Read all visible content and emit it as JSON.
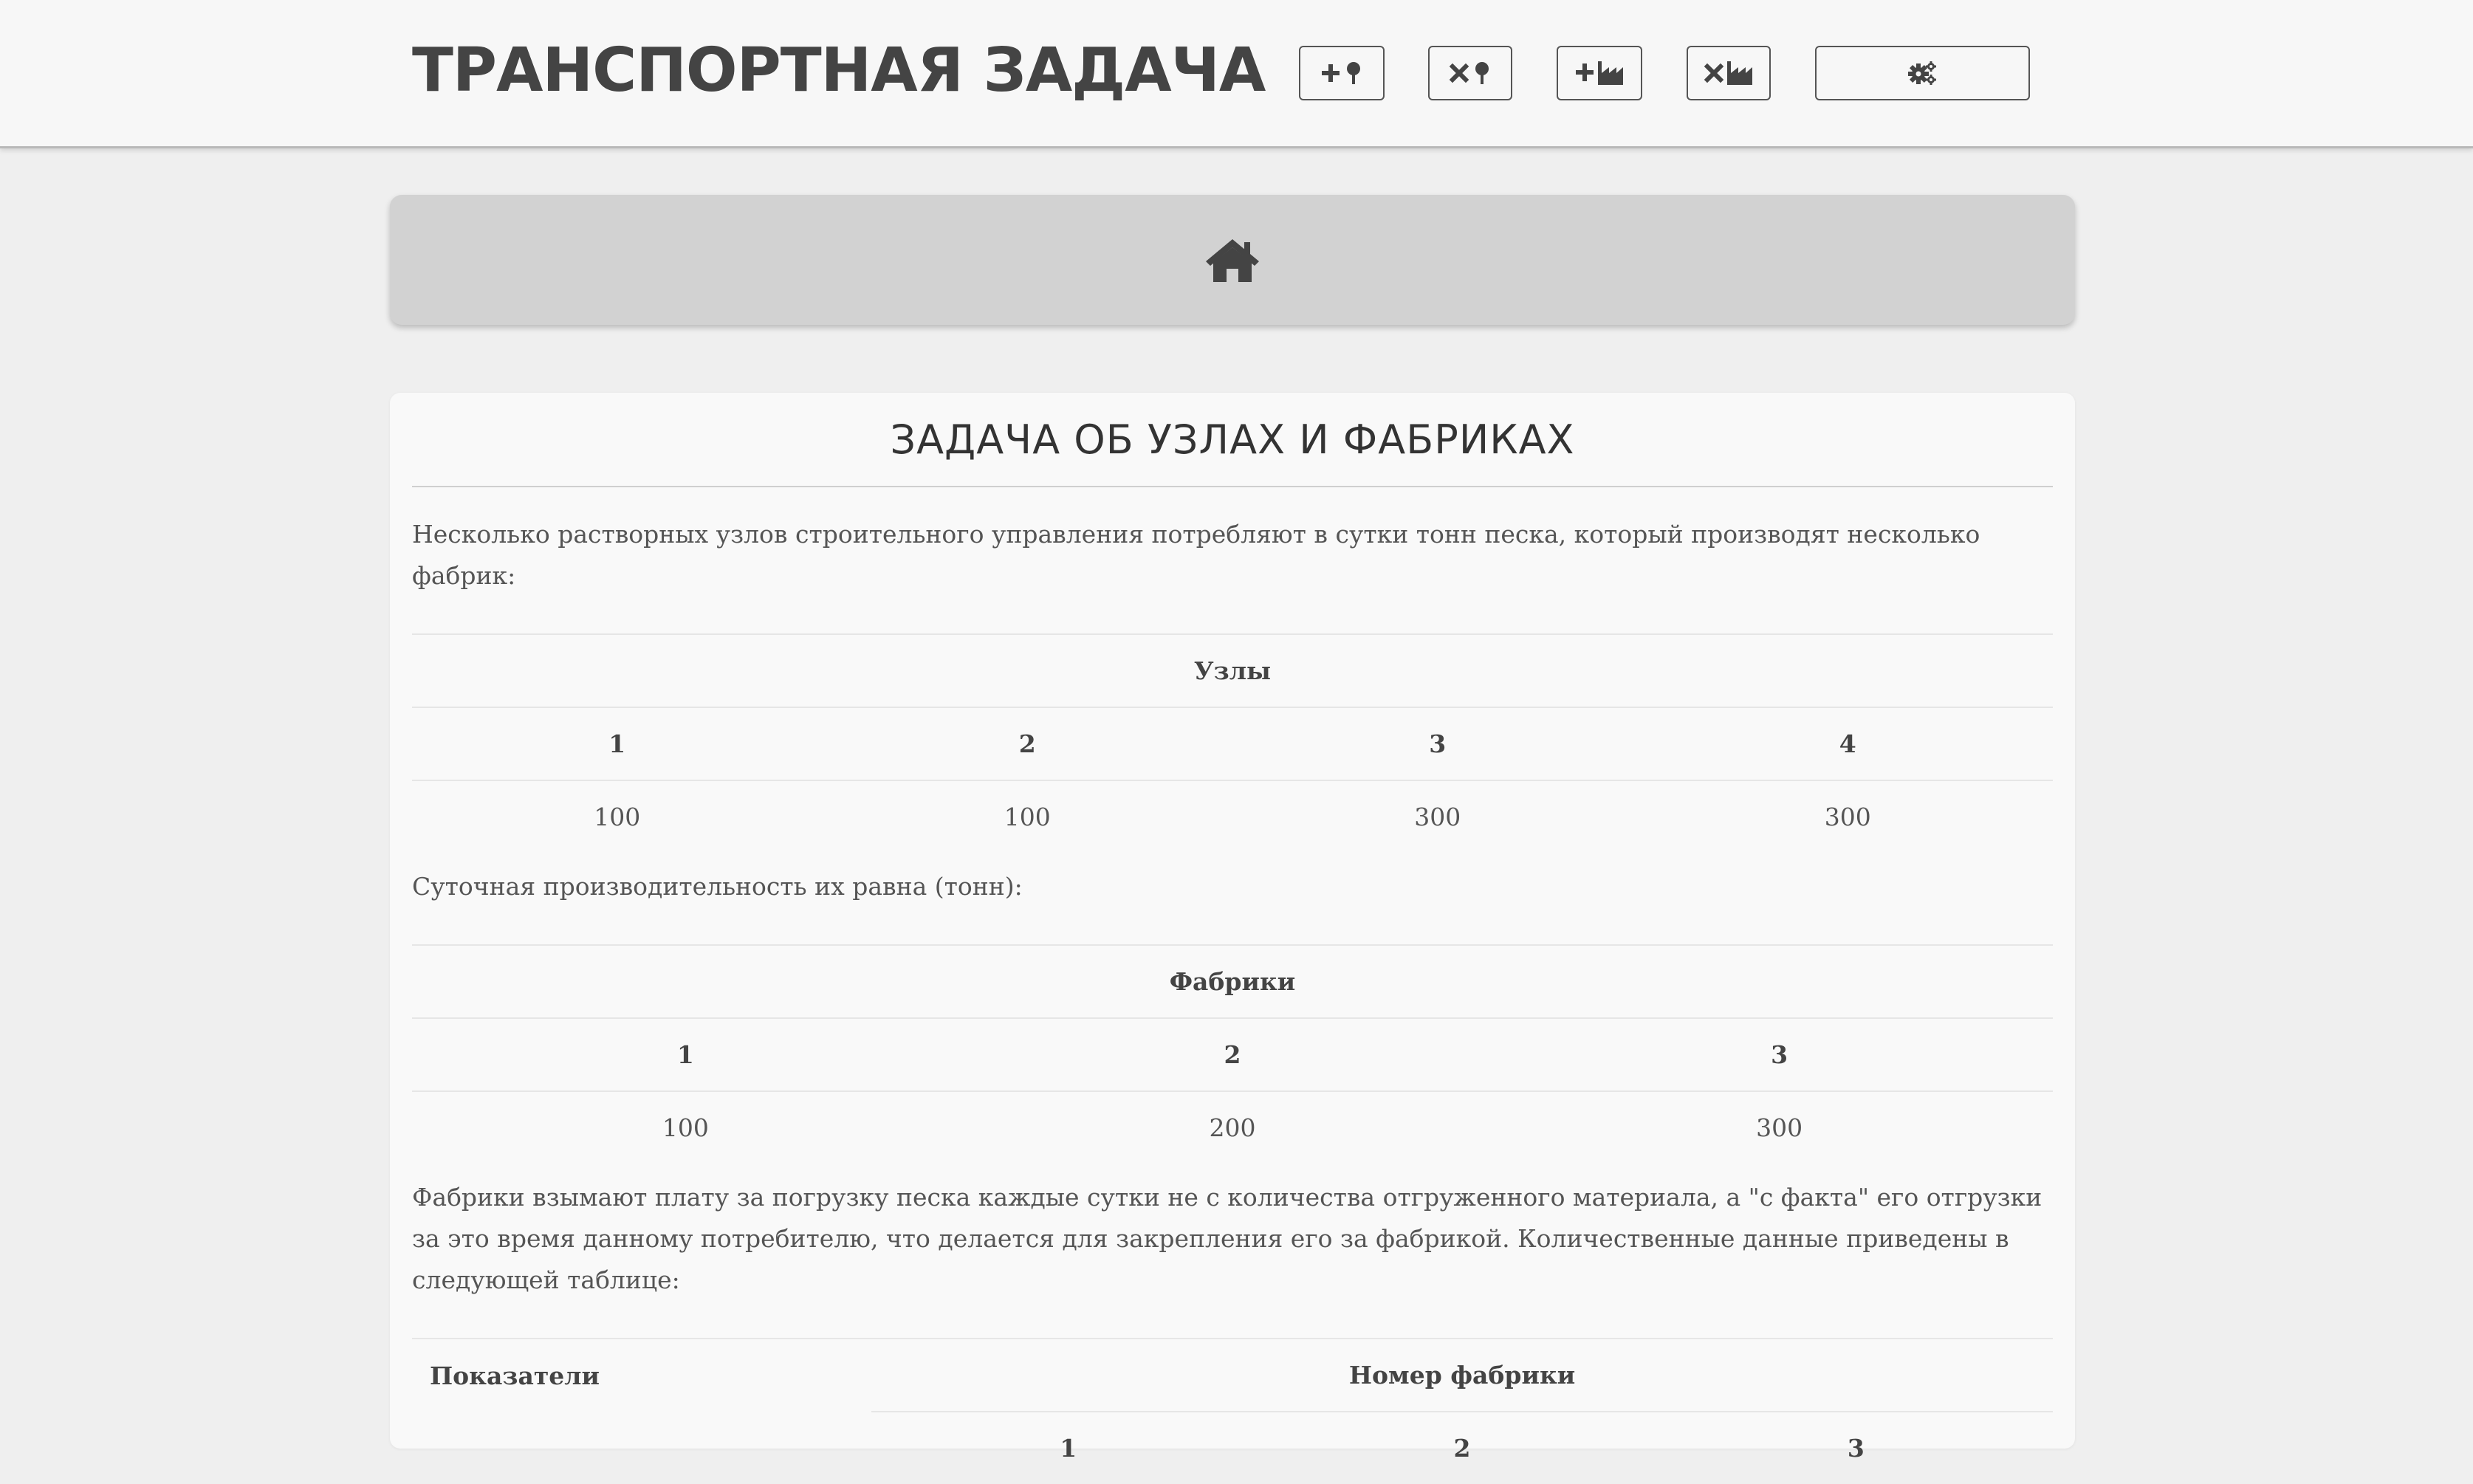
{
  "header": {
    "title": "ТРАНСПОРТНАЯ ЗАДАЧА",
    "buttons": [
      {
        "icon": "plus-node-icon"
      },
      {
        "icon": "times-node-icon"
      },
      {
        "icon": "plus-factory-icon"
      },
      {
        "icon": "times-factory-icon"
      },
      {
        "icon": "gears-icon"
      }
    ]
  },
  "home": {
    "icon": "home-icon"
  },
  "card": {
    "title": "ЗАДАЧА ОБ УЗЛАХ И ФАБРИКАХ",
    "intro": "Несколько растворных узлов строительного управления потребляют в сутки тонн песка, который производят несколько фабрик:",
    "nodes_table": {
      "caption": "Узлы",
      "headers": [
        "1",
        "2",
        "3",
        "4"
      ],
      "values": [
        "100",
        "100",
        "300",
        "300"
      ]
    },
    "capacity_text": "Суточная производительность их равна (тонн):",
    "factories_table": {
      "caption": "Фабрики",
      "headers": [
        "1",
        "2",
        "3"
      ],
      "values": [
        "100",
        "200",
        "300"
      ]
    },
    "fees_text": "Фабрики взымают плату за погрузку песка каждые сутки не с количества отгруженного материала, а \"с факта\" его отгрузки за это время данному потребителю, что делается для закрепления его за фабрикой. Количественные данные приведены в следующей таблице:",
    "indicators_table": {
      "col_indicators": "Показатели",
      "col_factory_number": "Номер фабрики",
      "factory_numbers": [
        "1",
        "2",
        "3"
      ]
    }
  }
}
